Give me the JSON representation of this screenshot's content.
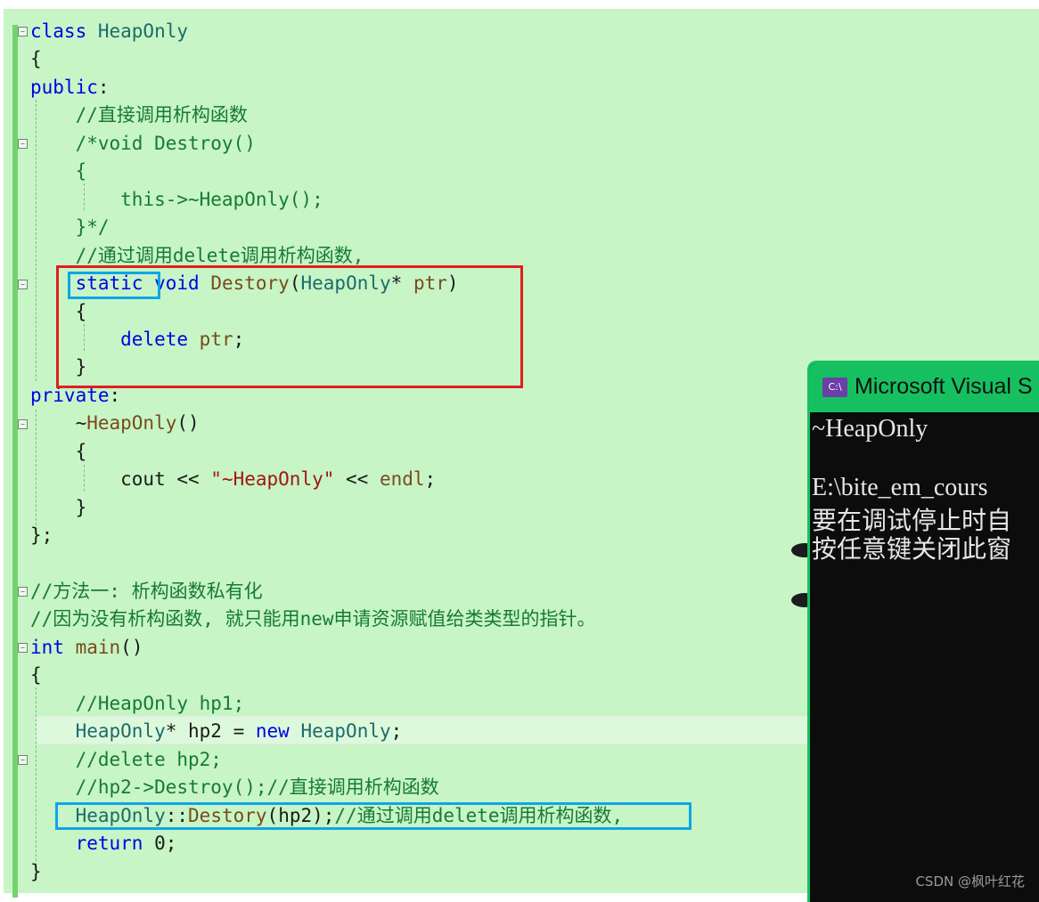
{
  "code": {
    "lines": [
      [
        {
          "t": "class ",
          "c": "kw"
        },
        {
          "t": "HeapOnly",
          "c": "ty"
        }
      ],
      [
        {
          "t": "{",
          "c": "pl"
        }
      ],
      [
        {
          "t": "public",
          "c": "kw"
        },
        {
          "t": ":",
          "c": "pl"
        }
      ],
      [
        {
          "t": "    //直接调用析构函数",
          "c": "cm"
        }
      ],
      [
        {
          "t": "    /*void Destroy()",
          "c": "cm"
        }
      ],
      [
        {
          "t": "    {",
          "c": "cm"
        }
      ],
      [
        {
          "t": "        this->~HeapOnly();",
          "c": "cm"
        }
      ],
      [
        {
          "t": "    }*/",
          "c": "cm"
        }
      ],
      [
        {
          "t": "    //通过调用delete调用析构函数,",
          "c": "cm"
        }
      ],
      [
        {
          "t": "    ",
          "c": "pl"
        },
        {
          "t": "static",
          "c": "kw"
        },
        {
          "t": " ",
          "c": "pl"
        },
        {
          "t": "void",
          "c": "kw"
        },
        {
          "t": " ",
          "c": "pl"
        },
        {
          "t": "Destory",
          "c": "fn"
        },
        {
          "t": "(",
          "c": "pl"
        },
        {
          "t": "HeapOnly",
          "c": "ty"
        },
        {
          "t": "* ",
          "c": "pl"
        },
        {
          "t": "ptr",
          "c": "fn"
        },
        {
          "t": ")",
          "c": "pl"
        }
      ],
      [
        {
          "t": "    {",
          "c": "pl"
        }
      ],
      [
        {
          "t": "        ",
          "c": "pl"
        },
        {
          "t": "delete",
          "c": "kw"
        },
        {
          "t": " ",
          "c": "pl"
        },
        {
          "t": "ptr",
          "c": "fn"
        },
        {
          "t": ";",
          "c": "pl"
        }
      ],
      [
        {
          "t": "    }",
          "c": "pl"
        }
      ],
      [
        {
          "t": "private",
          "c": "kw"
        },
        {
          "t": ":",
          "c": "pl"
        }
      ],
      [
        {
          "t": "    ~",
          "c": "pl"
        },
        {
          "t": "HeapOnly",
          "c": "fn"
        },
        {
          "t": "()",
          "c": "pl"
        }
      ],
      [
        {
          "t": "    {",
          "c": "pl"
        }
      ],
      [
        {
          "t": "        cout << ",
          "c": "pl"
        },
        {
          "t": "\"~HeapOnly\"",
          "c": "str"
        },
        {
          "t": " << ",
          "c": "pl"
        },
        {
          "t": "endl",
          "c": "fn"
        },
        {
          "t": ";",
          "c": "pl"
        }
      ],
      [
        {
          "t": "    }",
          "c": "pl"
        }
      ],
      [
        {
          "t": "};",
          "c": "pl"
        }
      ],
      [
        {
          "t": "",
          "c": "pl"
        }
      ],
      [
        {
          "t": "//方法一: 析构函数私有化",
          "c": "cm"
        }
      ],
      [
        {
          "t": "//因为没有析构函数, 就只能用new申请资源赋值给类类型的指针。",
          "c": "cm"
        }
      ],
      [
        {
          "t": "int",
          "c": "kw"
        },
        {
          "t": " ",
          "c": "pl"
        },
        {
          "t": "main",
          "c": "fn"
        },
        {
          "t": "()",
          "c": "pl"
        }
      ],
      [
        {
          "t": "{",
          "c": "pl"
        }
      ],
      [
        {
          "t": "    //HeapOnly hp1;",
          "c": "cm"
        }
      ],
      [
        {
          "t": "    ",
          "c": "pl"
        },
        {
          "t": "HeapOnly",
          "c": "ty"
        },
        {
          "t": "* hp2 = ",
          "c": "pl"
        },
        {
          "t": "new",
          "c": "kw"
        },
        {
          "t": " ",
          "c": "pl"
        },
        {
          "t": "HeapOnly",
          "c": "ty"
        },
        {
          "t": ";",
          "c": "pl"
        }
      ],
      [
        {
          "t": "    //delete hp2;",
          "c": "cm"
        }
      ],
      [
        {
          "t": "    //hp2->Destroy();//直接调用析构函数",
          "c": "cm"
        }
      ],
      [
        {
          "t": "    ",
          "c": "pl"
        },
        {
          "t": "HeapOnly",
          "c": "ty"
        },
        {
          "t": "::",
          "c": "pl"
        },
        {
          "t": "Destory",
          "c": "fn"
        },
        {
          "t": "(hp2);",
          "c": "pl"
        },
        {
          "t": "//通过调用delete调用析构函数,",
          "c": "cm"
        }
      ],
      [
        {
          "t": "    ",
          "c": "pl"
        },
        {
          "t": "return",
          "c": "kw"
        },
        {
          "t": " 0;",
          "c": "pl"
        }
      ],
      [
        {
          "t": "}",
          "c": "pl"
        }
      ]
    ]
  },
  "console": {
    "title": "Microsoft Visual S",
    "icon": "C:\\",
    "lines": [
      "~HeapOnly",
      "",
      "E:\\bite_em_cours",
      "要在调试停止时自",
      "按任意键关闭此窗"
    ]
  },
  "watermark": "CSDN @枫叶红花",
  "colors": {
    "editor_bg": "#c7f5c5",
    "console_accent": "#16c060",
    "highlight_red": "#e21e1e",
    "highlight_blue": "#0ea5e9"
  }
}
